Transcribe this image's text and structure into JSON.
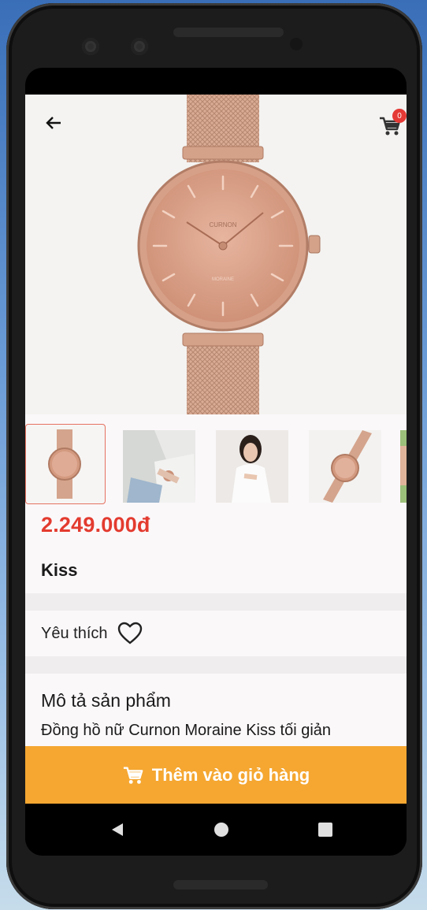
{
  "colors": {
    "accent": "#f5a731",
    "price": "#e33b2f",
    "badge": "#e53935"
  },
  "header": {
    "back_icon": "arrow-left-icon",
    "cart_icon": "shopping-cart-icon",
    "cart_count": "0"
  },
  "product": {
    "price": "2.249.000đ",
    "name": "Kiss",
    "thumbnails": [
      "watch-front",
      "wrist-lifestyle",
      "model-portrait",
      "watch-angle",
      "hand-partial"
    ]
  },
  "favorite": {
    "label": "Yêu thích",
    "icon": "heart-outline-icon"
  },
  "description": {
    "title": "Mô tả sản phẩm",
    "text": "Đồng hồ nữ Curnon Moraine Kiss tối giản"
  },
  "add_to_cart": {
    "label": "Thêm vào giỏ hàng",
    "icon": "shopping-cart-icon"
  },
  "nav": {
    "back": "nav-back-icon",
    "home": "nav-home-icon",
    "recents": "nav-recents-icon"
  }
}
